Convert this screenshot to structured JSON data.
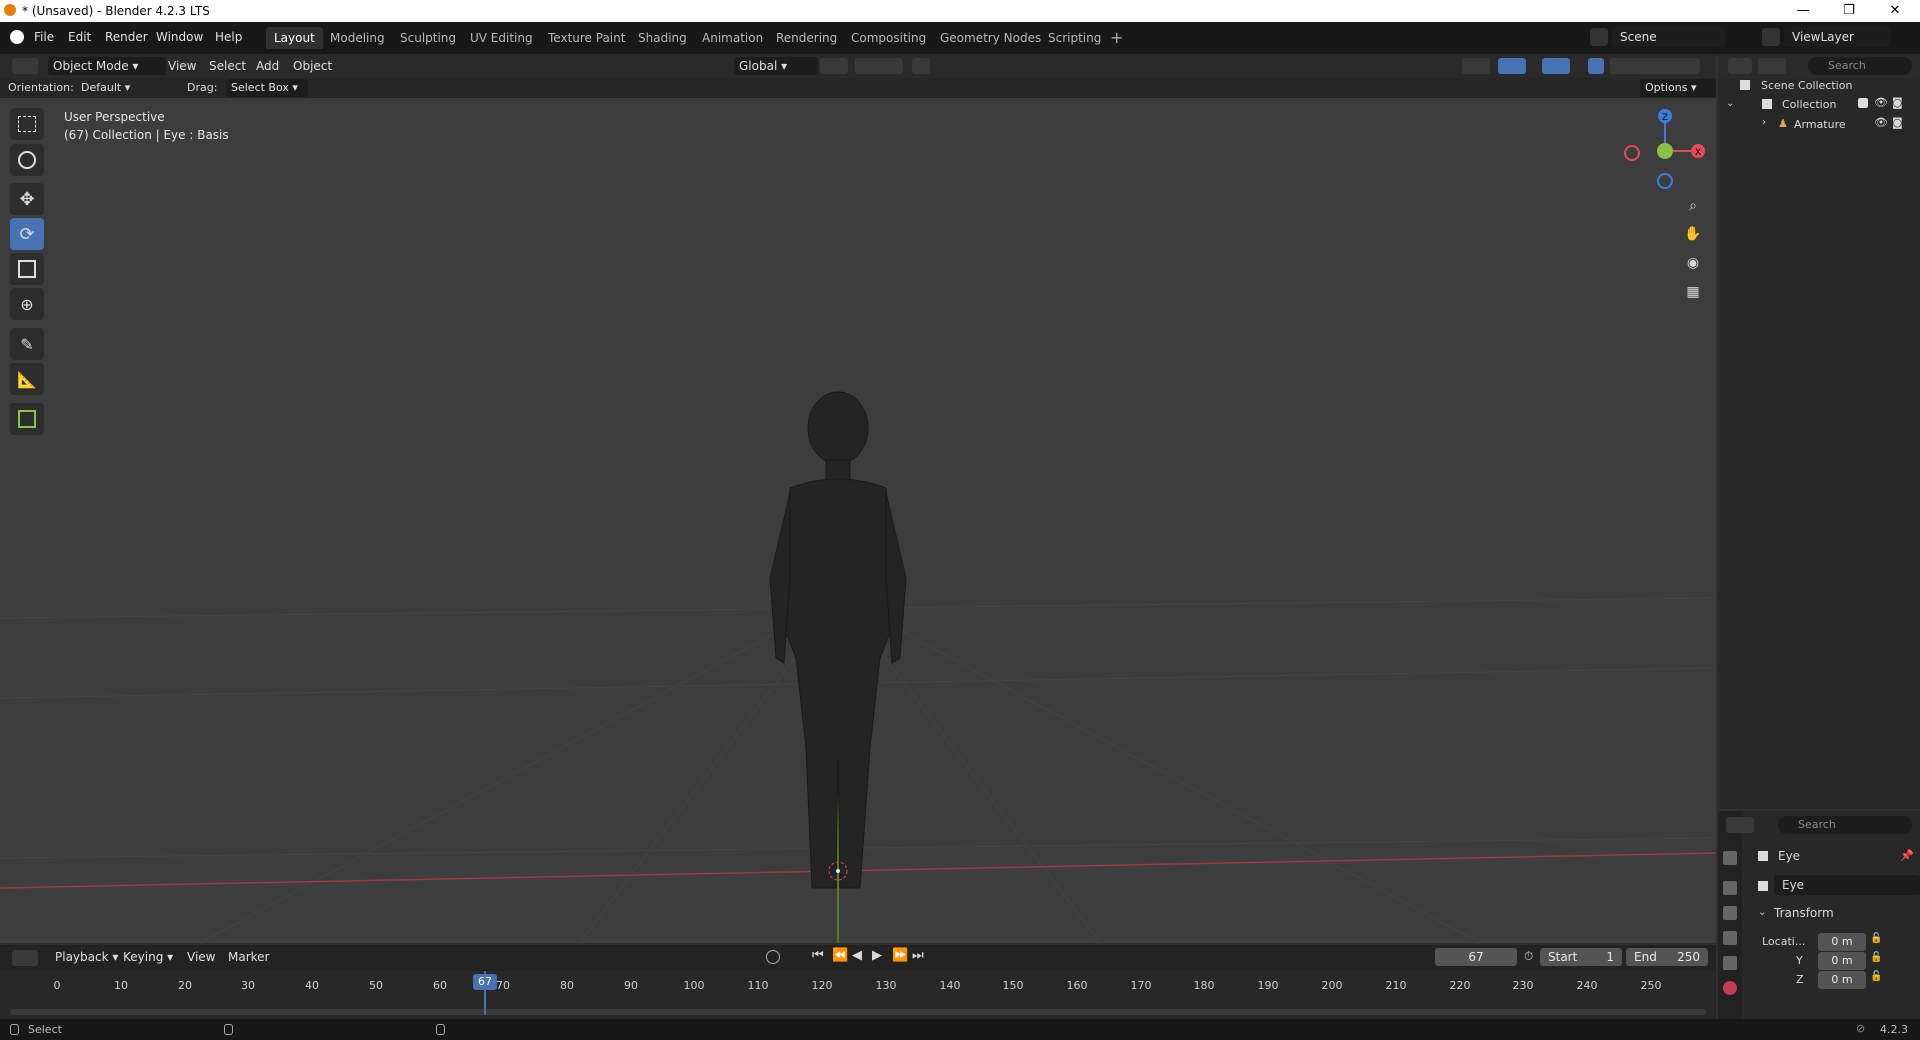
{
  "window": {
    "title": "* (Unsaved) - Blender 4.2.3 LTS",
    "min": "—",
    "max": "❐",
    "close": "✕"
  },
  "menus": [
    "File",
    "Edit",
    "Render",
    "Window",
    "Help"
  ],
  "workspaces": [
    "Layout",
    "Modeling",
    "Sculpting",
    "UV Editing",
    "Texture Paint",
    "Shading",
    "Animation",
    "Rendering",
    "Compositing",
    "Geometry Nodes",
    "Scripting"
  ],
  "scene": {
    "name": "Scene",
    "view_layer": "ViewLayer"
  },
  "header": {
    "mode": "Object Mode",
    "view": "View",
    "select": "Select",
    "add": "Add",
    "object": "Object",
    "transform": "Global"
  },
  "options_bar": {
    "orientation_label": "Orientation:",
    "orientation": "Default",
    "drag_label": "Drag:",
    "drag": "Select Box",
    "options": "Options"
  },
  "viewport": {
    "perspective": "User Perspective",
    "info": "(67) Collection | Eye : Basis"
  },
  "gizmo": {
    "x": "X",
    "y": "Y",
    "z": "Z"
  },
  "outliner": {
    "search_placeholder": "Search",
    "root": "Scene Collection",
    "collection": "Collection",
    "armature": "Armature"
  },
  "properties": {
    "search_placeholder": "Search",
    "object_name": "Eye",
    "data_name": "Eye",
    "panel": "Transform",
    "location_label": "Locati...",
    "y_label": "Y",
    "z_label": "Z",
    "x_value": "0 m",
    "y_value": "0 m",
    "z_value": "0 m"
  },
  "timeline": {
    "playback": "Playback",
    "keying": "Keying",
    "view": "View",
    "marker": "Marker",
    "current_frame": "67",
    "start_label": "Start",
    "start": "1",
    "end_label": "End",
    "end": "250",
    "ticks": [
      "0",
      "10",
      "20",
      "30",
      "40",
      "50",
      "60",
      "70",
      "80",
      "90",
      "100",
      "110",
      "120",
      "130",
      "140",
      "150",
      "160",
      "170",
      "180",
      "190",
      "200",
      "210",
      "220",
      "230",
      "240",
      "250"
    ],
    "frame_badge": "67"
  },
  "status": {
    "left": "Select",
    "version": "4.2.3"
  },
  "colors": {
    "accent": "#4772b3",
    "x_axis": "#e34a5a",
    "y_axis": "#8bc34a",
    "z_axis": "#3c7ee0"
  }
}
